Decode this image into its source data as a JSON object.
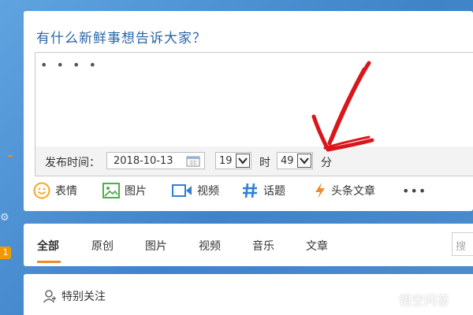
{
  "left_rail": {
    "badge_count": "1",
    "settings_icon": "gear-icon"
  },
  "composer": {
    "prompt": "有什么新鲜事想告诉大家？",
    "text_value": "• • • •",
    "schedule": {
      "label": "发布时间：",
      "date": "2018-10-13",
      "hour": "19",
      "hour_unit": "时",
      "minute": "49",
      "minute_unit": "分"
    },
    "toolbar": [
      {
        "label": "表情",
        "icon": "smiley-icon",
        "color": "#f5a623"
      },
      {
        "label": "图片",
        "icon": "image-icon",
        "color": "#4caf50"
      },
      {
        "label": "视频",
        "icon": "video-icon",
        "color": "#2f7fd8"
      },
      {
        "label": "话题",
        "icon": "hashtag-icon",
        "color": "#2f7fd8"
      },
      {
        "label": "头条文章",
        "icon": "lightning-icon",
        "color": "#f08b2b"
      }
    ],
    "more_label": "•••"
  },
  "feed": {
    "tabs": [
      "全部",
      "原创",
      "图片",
      "视频",
      "音乐",
      "文章"
    ],
    "active_tab": "全部",
    "search_placeholder": "搜"
  },
  "special_follow": {
    "label": "特别关注"
  },
  "watermark": {
    "text": "悟空问答"
  },
  "colors": {
    "background": "#4d8fd0",
    "prompt_text": "#2a66a8",
    "accent": "#f08b2b",
    "annotation": "#d8161b"
  }
}
